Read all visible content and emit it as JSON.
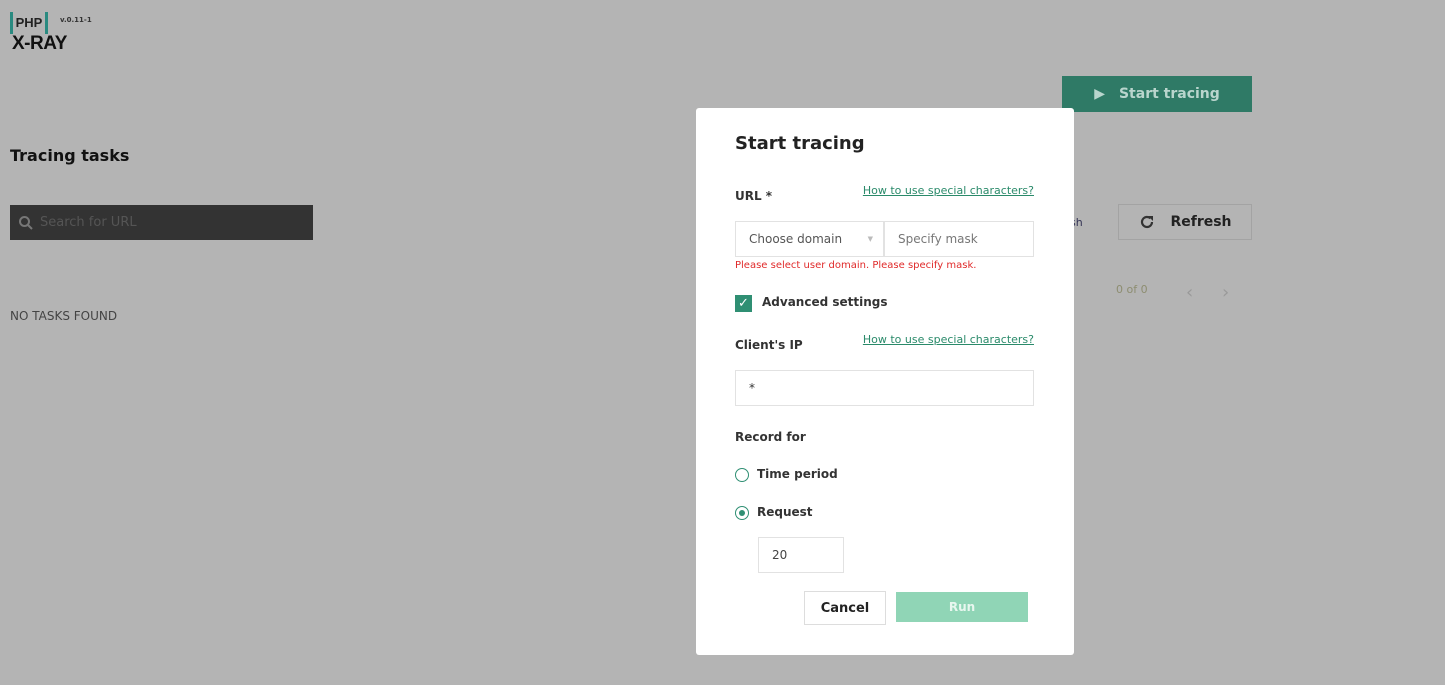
{
  "logo": {
    "php": "PHP",
    "xray": "X-RAY",
    "version": "v.0.11-1"
  },
  "header": {
    "start_tracing": "Start tracing"
  },
  "page": {
    "title": "Tracing tasks",
    "search_placeholder": "Search for URL",
    "empty": "NO TASKS FOUND",
    "auto_refresh_partial": "sh",
    "refresh": "Refresh",
    "pagination": "0 of 0"
  },
  "modal": {
    "title": "Start tracing",
    "url_label": "URL *",
    "help_link": "How to use special characters?",
    "domain_placeholder": "Choose domain",
    "mask_placeholder": "Specify mask",
    "error": "Please select user domain. Please specify mask.",
    "advanced": "Advanced settings",
    "advanced_checked": true,
    "ip_label": "Client's IP",
    "ip_value": "*",
    "record_label": "Record for",
    "opt_time": "Time period",
    "opt_request": "Request",
    "selected": "Request",
    "request_count": "20",
    "cancel": "Cancel",
    "run": "Run"
  },
  "colors": {
    "accent": "#2f8f73",
    "error": "#e02a2a",
    "run_disabled": "#90d5b6"
  }
}
